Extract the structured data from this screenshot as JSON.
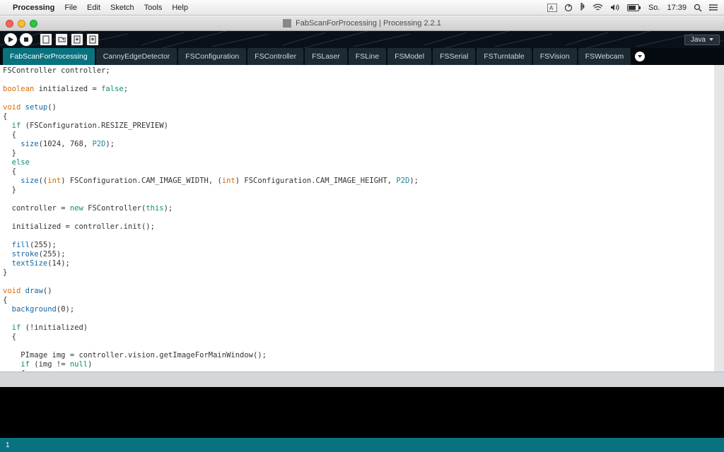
{
  "menubar": {
    "app": "Processing",
    "items": [
      "File",
      "Edit",
      "Sketch",
      "Tools",
      "Help"
    ],
    "clock_day": "So.",
    "clock_time": "17:39"
  },
  "window": {
    "title": "FabScanForProcessing | Processing 2.2.1"
  },
  "toolbar": {
    "language": "Java"
  },
  "tabs": [
    {
      "label": "FabScanForProcessing",
      "active": true
    },
    {
      "label": "CannyEdgeDetector"
    },
    {
      "label": "FSConfiguration"
    },
    {
      "label": "FSController"
    },
    {
      "label": "FSLaser"
    },
    {
      "label": "FSLine"
    },
    {
      "label": "FSModel"
    },
    {
      "label": "FSSerial"
    },
    {
      "label": "FSTurntable"
    },
    {
      "label": "FSVision"
    },
    {
      "label": "FSWebcam"
    }
  ],
  "status": {
    "line": "1"
  },
  "code": {
    "l1a": "FSController controller;",
    "l3a": "boolean",
    "l3b": " initialized = ",
    "l3c": "false",
    "l3d": ";",
    "l5a": "void",
    "l5b": " ",
    "l5c": "setup",
    "l5d": "()",
    "l6": "{",
    "l7a": "  if",
    "l7b": " (FSConfiguration.RESIZE_PREVIEW)",
    "l8": "  {",
    "l9a": "    ",
    "l9b": "size",
    "l9c": "(1024, 768, ",
    "l9d": "P2D",
    "l9e": ");",
    "l10": "  }",
    "l11a": "  ",
    "l11b": "else",
    "l12": "  {",
    "l13a": "    ",
    "l13b": "size",
    "l13c": "((",
    "l13d": "int",
    "l13e": ") FSConfiguration.CAM_IMAGE_WIDTH, (",
    "l13f": "int",
    "l13g": ") FSConfiguration.CAM_IMAGE_HEIGHT, ",
    "l13h": "P2D",
    "l13i": ");",
    "l14": "  }",
    "l16a": "  controller = ",
    "l16b": "new",
    "l16c": " FSController(",
    "l16d": "this",
    "l16e": ");",
    "l18": "  initialized = controller.init();",
    "l20a": "  ",
    "l20b": "fill",
    "l20c": "(255);",
    "l21a": "  ",
    "l21b": "stroke",
    "l21c": "(255);",
    "l22a": "  ",
    "l22b": "textSize",
    "l22c": "(14);",
    "l23": "}",
    "l25a": "void",
    "l25b": " ",
    "l25c": "draw",
    "l25d": "()",
    "l26": "{",
    "l27a": "  ",
    "l27b": "background",
    "l27c": "(0);",
    "l29a": "  if",
    "l29b": " (!initialized)",
    "l30": "  {",
    "l32": "    PImage img = controller.vision.getImageForMainWindow();",
    "l33a": "    if",
    "l33b": " (img != ",
    "l33c": "null",
    "l33d": ")",
    "l34": "    {"
  }
}
